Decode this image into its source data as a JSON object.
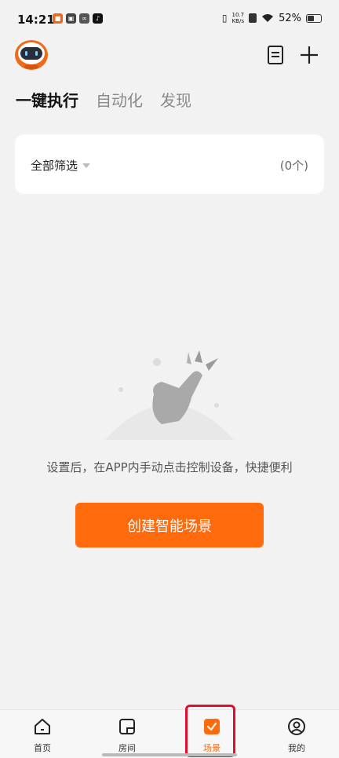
{
  "status_bar": {
    "time": "14:21",
    "net_speed_value": "10.7",
    "net_speed_unit": "KB/s",
    "battery_percent": "52%",
    "battery_level": 0.52
  },
  "tabs": [
    {
      "label": "一键执行",
      "active": true
    },
    {
      "label": "自动化",
      "active": false
    },
    {
      "label": "发现",
      "active": false
    }
  ],
  "filter": {
    "label": "全部筛选",
    "count": "(0个)"
  },
  "empty_state": {
    "hint": "设置后，在APP内手动点击控制设备，快捷便利"
  },
  "create_button": {
    "label": "创建智能场景"
  },
  "bottom_nav": [
    {
      "label": "首页",
      "icon": "home-icon",
      "active": false
    },
    {
      "label": "房间",
      "icon": "room-icon",
      "active": false
    },
    {
      "label": "场景",
      "icon": "scene-check-icon",
      "active": true
    },
    {
      "label": "我的",
      "icon": "profile-icon",
      "active": false
    }
  ],
  "colors": {
    "accent": "#ff6a0d",
    "highlight": "#e0102a",
    "background": "#f2f2f2"
  }
}
